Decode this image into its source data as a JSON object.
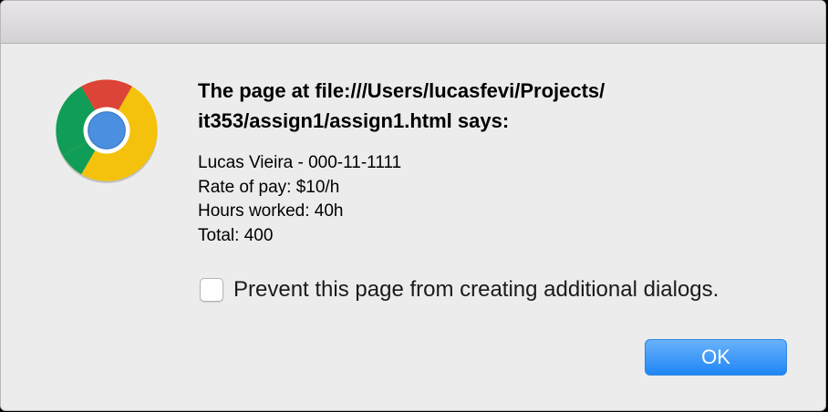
{
  "dialog": {
    "app_icon": "chrome-logo-icon",
    "heading_lines": [
      "The page at file:///Users/lucasfevi/Projects/",
      "it353/assign1/assign1.html says:"
    ],
    "message_lines": [
      "Lucas Vieira - 000-11-1111",
      "Rate of pay: $10/h",
      "Hours worked: 40h",
      "Total: 400"
    ],
    "prevent_checkbox": {
      "label": "Prevent this page from creating additional dialogs.",
      "checked": false
    },
    "ok_label": "OK"
  },
  "colors": {
    "dialog_background": "#ececec",
    "button_accent": "#1e86f6",
    "chrome_red": "#db4437",
    "chrome_yellow": "#f4c20d",
    "chrome_green": "#0f9d58",
    "chrome_blue": "#4285f4"
  }
}
